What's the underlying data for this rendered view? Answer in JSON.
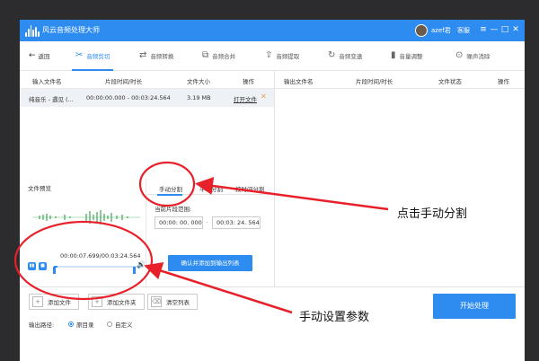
{
  "window": {
    "title": "风云音频处理大师",
    "user": "azef君",
    "service": "客服",
    "controls": [
      "≡",
      "—",
      "□",
      "✕"
    ]
  },
  "toolbar": {
    "back": "返回",
    "items": [
      {
        "label": "音频剪切",
        "icon": "scissors-icon",
        "glyph": "✂"
      },
      {
        "label": "音频转换",
        "icon": "convert-icon",
        "glyph": "⇄"
      },
      {
        "label": "音频合并",
        "icon": "merge-icon",
        "glyph": "⧉"
      },
      {
        "label": "音频提取",
        "icon": "extract-icon",
        "glyph": "⇪"
      },
      {
        "label": "音频变速",
        "icon": "speed-icon",
        "glyph": "↻"
      },
      {
        "label": "音量调整",
        "icon": "volume-bars-icon",
        "glyph": "▮"
      },
      {
        "label": "噪声消除",
        "icon": "denoise-icon",
        "glyph": "⊙"
      }
    ]
  },
  "left_table": {
    "headers": [
      "输入文件名",
      "片段时间/时长",
      "文件大小",
      "操作"
    ],
    "row": {
      "name": "纯音乐 - 遇见 (...",
      "time": "00:00:00.000 - 00:03:24.564",
      "size": "3.19 MB",
      "action": "打开文件",
      "remove": "✕"
    }
  },
  "right_table": {
    "headers": [
      "输出文件名",
      "片段时间/时长",
      "文件状态",
      "操作"
    ]
  },
  "preview": {
    "label": "文件预览",
    "time": "00:00:07.699/00:03:24.564",
    "play": "▮▮",
    "stop": "■",
    "volume": "🔊",
    "progress": 0.04
  },
  "split": {
    "tabs": [
      "手动分割",
      "平均分割",
      "按时间分割"
    ],
    "range_label": "当前片段范围:",
    "start": "00:00: 00. 000",
    "end": "00:03: 24. 564",
    "dash": "-",
    "confirm": "确认并添加到输出列表"
  },
  "bottom": {
    "add_file": "添加文件",
    "add_folder": "添加文件夹",
    "clear": "清空列表",
    "output_label": "输出路径:",
    "radio_original": "原目录",
    "radio_custom": "自定义",
    "start": "开始处理"
  },
  "annotations": {
    "click_manual": "点击手动分割",
    "set_params": "手动设置参数"
  },
  "colors": {
    "accent": "#2e8cf0",
    "annotation": "#e8202a"
  }
}
